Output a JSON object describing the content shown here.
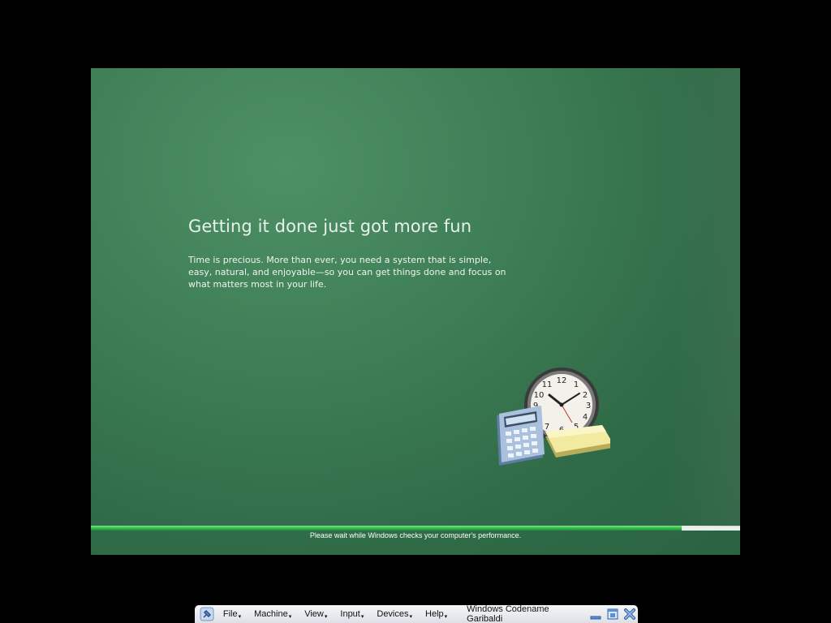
{
  "screen": {
    "headline": "Getting it done just got more fun",
    "body": "Time is precious. More than ever, you need a system that is simple, easy, natural, and enjoyable—so you can get things done and focus on what matters most in your life.",
    "status": "Please wait while Windows checks your computer's performance.",
    "progress_fraction": 0.91,
    "illustration_icons": [
      "clock-icon",
      "calculator-icon",
      "notepad-icon"
    ]
  },
  "menubar": {
    "pin_icon": "pin-icon",
    "items": [
      {
        "label": "File"
      },
      {
        "label": "Machine"
      },
      {
        "label": "View"
      },
      {
        "label": "Input"
      },
      {
        "label": "Devices"
      },
      {
        "label": "Help"
      }
    ],
    "vm_title": "Windows Codename Garibaldi",
    "window_icons": [
      "minimize-icon",
      "restore-icon",
      "close-icon"
    ]
  },
  "colors": {
    "background": "#3f7f57",
    "progress": "#31b94c",
    "track": "#e9efe9"
  }
}
